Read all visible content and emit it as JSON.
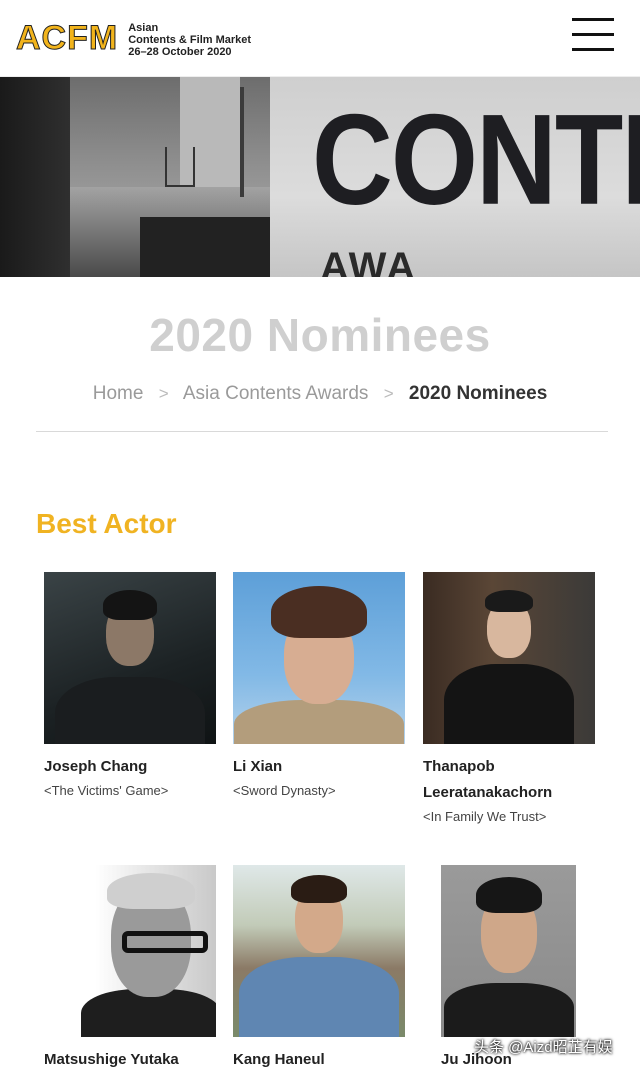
{
  "header": {
    "logo": "ACFM",
    "logo_lines": [
      "Asian",
      "Contents & Film Market",
      "26–28 October 2020"
    ]
  },
  "hero": {
    "sign_text": "CONTENT",
    "sign_sub": "AWA"
  },
  "page": {
    "title": "2020 Nominees"
  },
  "breadcrumb": {
    "items": [
      "Home",
      "Asia Contents Awards",
      "2020 Nominees"
    ],
    "separator": ">"
  },
  "section": {
    "title": "Best Actor"
  },
  "nominees": [
    {
      "name": "Joseph Chang",
      "work": "<The Victims' Game>"
    },
    {
      "name": "Li Xian",
      "work": "<Sword Dynasty>"
    },
    {
      "name": "Thanapob Leeratanakachorn",
      "work": "<In Family We Trust>"
    },
    {
      "name": "Matsushige Yutaka",
      "work": ""
    },
    {
      "name": "Kang Haneul",
      "work": ""
    },
    {
      "name": "Ju Jihoon",
      "work": ""
    }
  ],
  "watermark": "头条 @Aizd昭芷有娱",
  "colors": {
    "accent": "#f0b322",
    "title_gray": "#cfcfcf"
  }
}
